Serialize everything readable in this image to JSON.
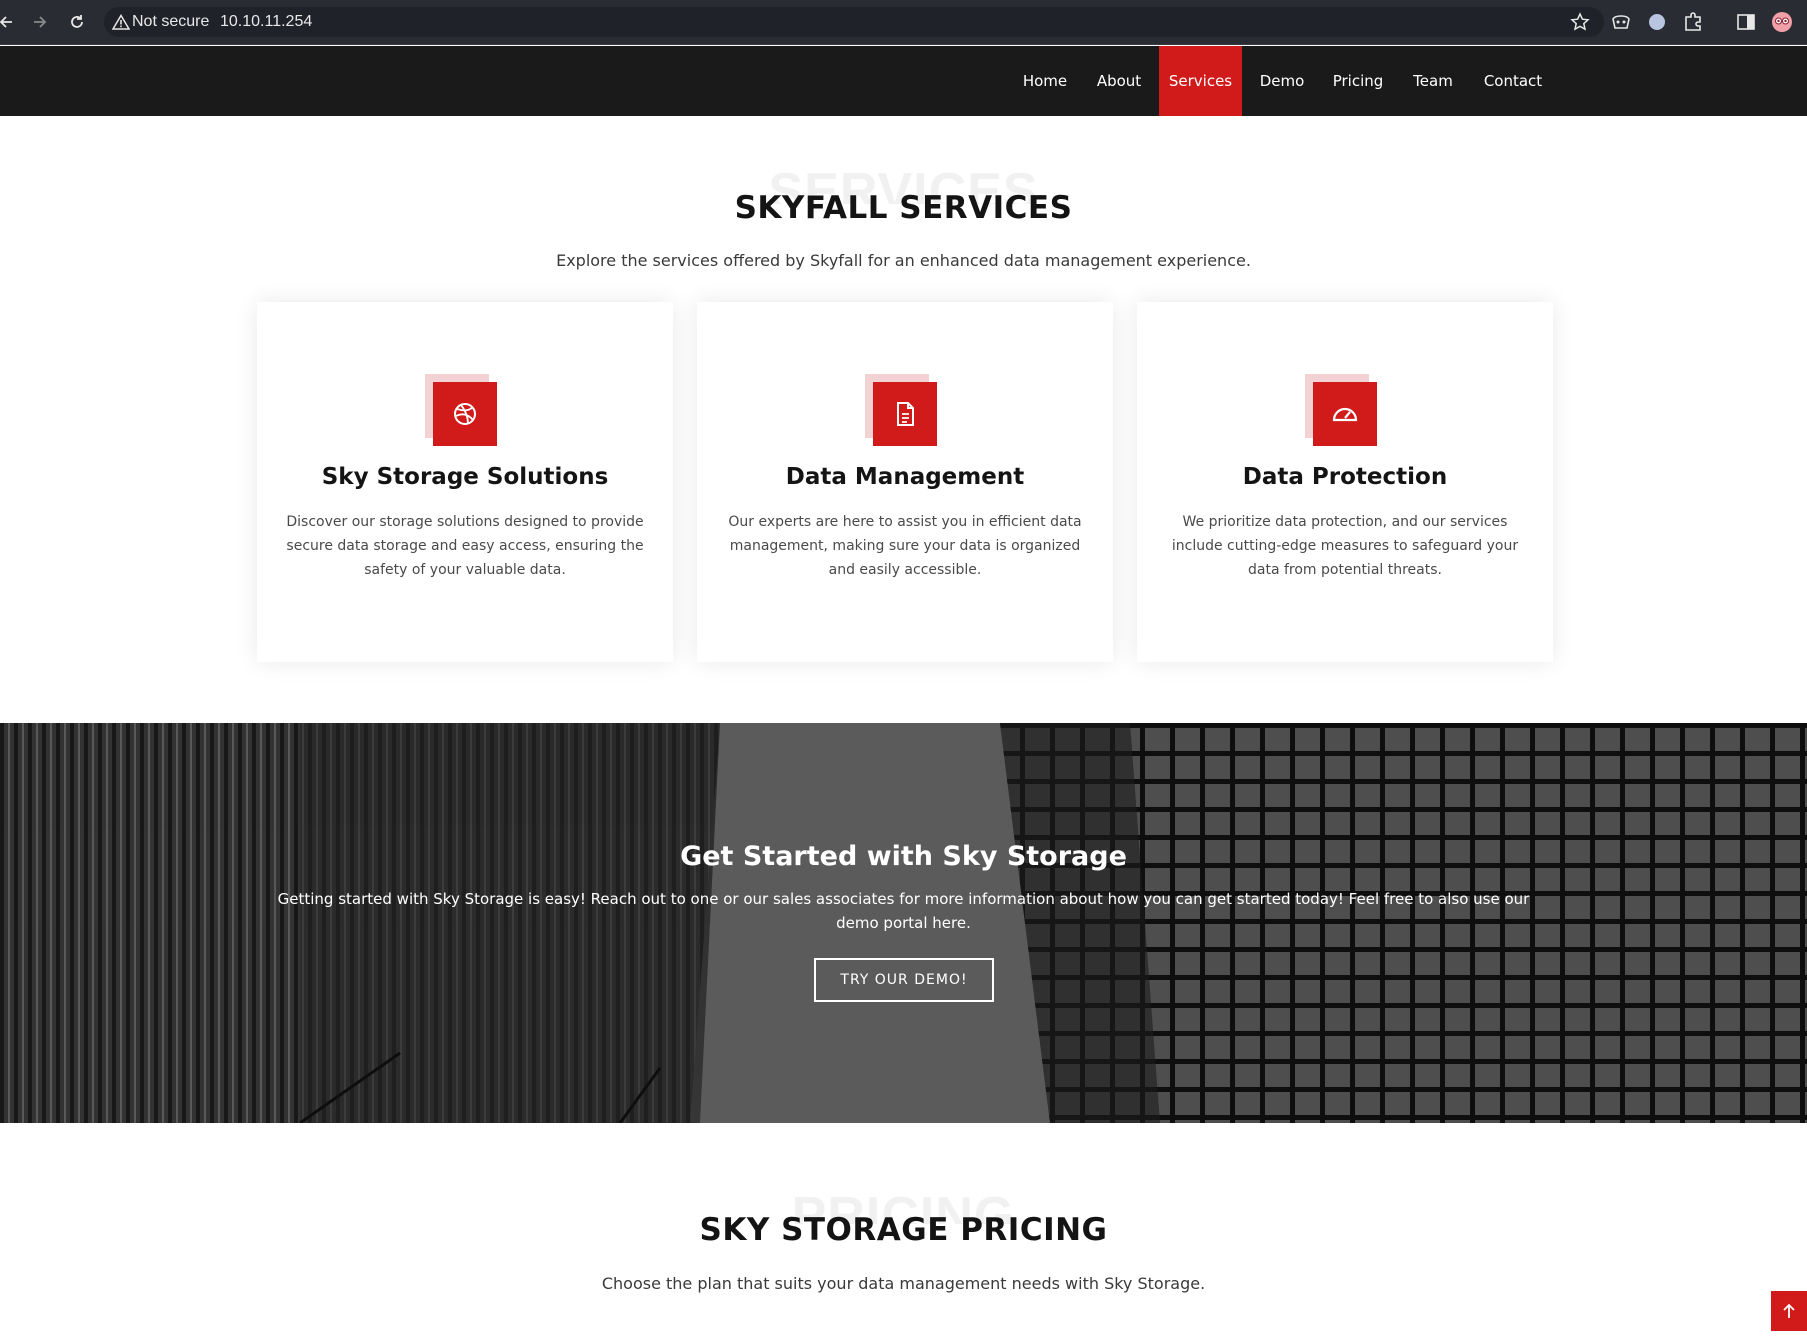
{
  "browser": {
    "security_label": "Not secure",
    "url": "10.10.11.254"
  },
  "nav": {
    "items": [
      {
        "label": "Home",
        "active": false
      },
      {
        "label": "About",
        "active": false
      },
      {
        "label": "Services",
        "active": true
      },
      {
        "label": "Demo",
        "active": false
      },
      {
        "label": "Pricing",
        "active": false
      },
      {
        "label": "Team",
        "active": false
      },
      {
        "label": "Contact",
        "active": false
      }
    ]
  },
  "services": {
    "ghost": "SERVICES",
    "title": "SKYFALL SERVICES",
    "subtitle": "Explore the services offered by Skyfall for an enhanced data management experience.",
    "cards": [
      {
        "icon": "dribbble-icon",
        "title": "Sky Storage Solutions",
        "text": "Discover our storage solutions designed to provide secure data storage and easy access, ensuring the safety of your valuable data."
      },
      {
        "icon": "document-icon",
        "title": "Data Management",
        "text": "Our experts are here to assist you in efficient data management, making sure your data is organized and easily accessible."
      },
      {
        "icon": "speedometer-icon",
        "title": "Data Protection",
        "text": "We prioritize data protection, and our services include cutting-edge measures to safeguard your data from potential threats."
      }
    ]
  },
  "cta": {
    "title": "Get Started with Sky Storage",
    "text": "Getting started with Sky Storage is easy! Reach out to one or our sales associates for more information about how you can get started today! Feel free to also use our demo portal here.",
    "button_label": "TRY OUR DEMO!"
  },
  "pricing": {
    "ghost": "PRICING",
    "title": "SKY STORAGE PRICING",
    "subtitle": "Choose the plan that suits your data management needs with Sky Storage."
  },
  "colors": {
    "accent": "#d11a1a",
    "header_bg": "#1a1a1a",
    "browser_bg": "#2a2c34"
  }
}
